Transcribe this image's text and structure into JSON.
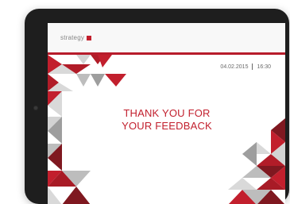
{
  "brand": {
    "logo_text": "strategy",
    "logo_color": "#c21f2d"
  },
  "header": {
    "accent_line_color": "#b71c2b"
  },
  "status": {
    "date": "04.02.2015",
    "time": "16:30"
  },
  "main": {
    "message_line_1": "THANK YOU FOR",
    "message_line_2": "YOUR FEEDBACK"
  },
  "icons": {
    "camera": "camera-icon"
  },
  "colors": {
    "primary_red": "#c21f2d",
    "dark_red": "#7f1820",
    "grey_light": "#d9d9d9",
    "grey_mid": "#bdbdbd",
    "grey_dark": "#9e9e9e",
    "bezel": "#1e1e1e"
  }
}
